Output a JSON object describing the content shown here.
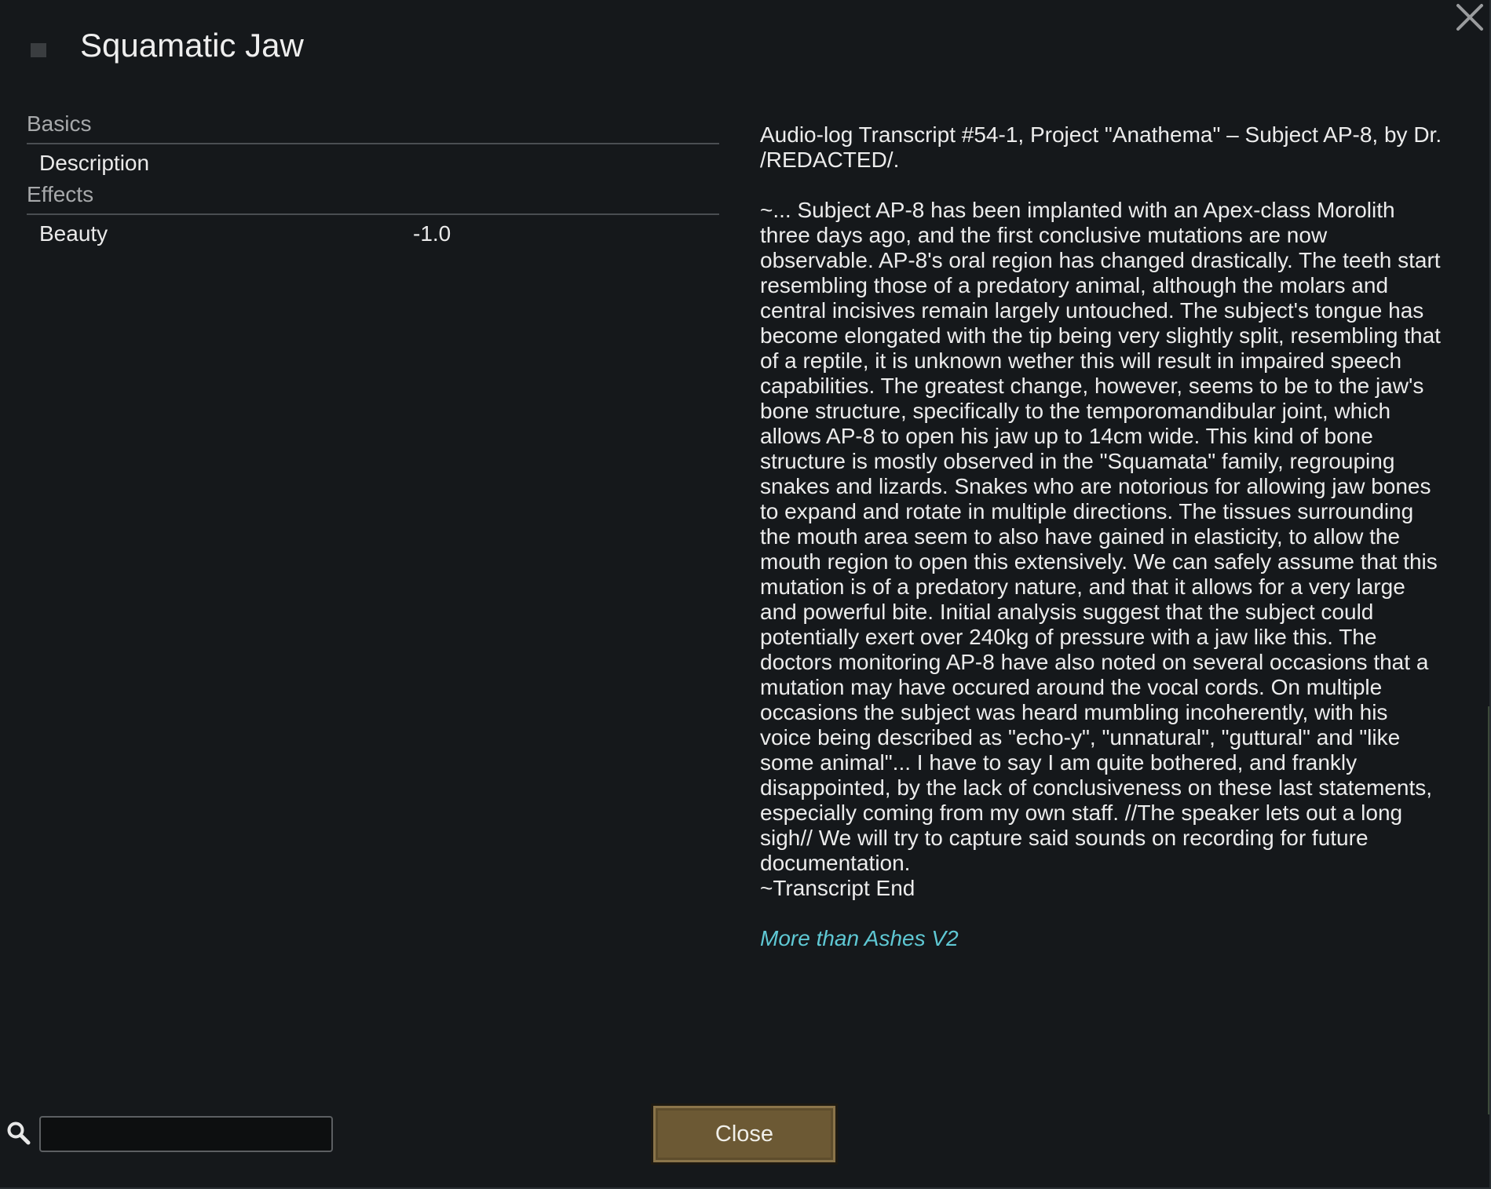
{
  "window": {
    "title": "Squamatic Jaw",
    "close_icon": "close-x-icon"
  },
  "stats": {
    "sections": [
      {
        "header": "Basics",
        "rows": [
          {
            "label": "Description",
            "value": ""
          }
        ]
      },
      {
        "header": "Effects",
        "rows": [
          {
            "label": "Beauty",
            "value": "-1.0"
          }
        ]
      }
    ]
  },
  "description": {
    "heading": "Audio-log Transcript #54-1, Project \"Anathema\" – Subject AP-8, by Dr. /REDACTED/.",
    "body": "~... Subject AP-8 has been implanted with an Apex-class Morolith three days ago, and the first conclusive mutations are now observable. AP-8's oral region has changed drastically. The teeth start resembling those of a predatory animal, although the molars and central incisives remain largely untouched. The subject's tongue has become elongated with the tip being very slightly split, resembling that of a reptile, it is unknown wether this will result in impaired speech capabilities. The greatest change, however, seems to be to the jaw's bone structure, specifically to the temporomandibular joint, which allows AP-8 to open his jaw up to 14cm wide. This kind of bone structure is mostly observed in the \"Squamata\" family, regrouping snakes and lizards. Snakes who are notorious for allowing jaw bones to expand and rotate in multiple directions. The tissues surrounding the mouth area seem to also have gained in elasticity, to allow the mouth region to open this extensively. We can safely assume that this mutation is of a predatory nature, and that it allows for a very large and powerful bite. Initial analysis suggest that the subject could potentially exert over 240kg of pressure with a jaw like this. The doctors monitoring AP-8 have also noted on several occasions that a mutation may have occured around the vocal cords. On multiple occasions the subject was heard mumbling incoherently, with his voice being described as \"echo-y\", \"unnatural\", \"guttural\" and \"like some animal\"... I have to say I am quite bothered, and frankly disappointed, by the lack of conclusiveness on these last statements, especially coming from my own staff. //The speaker lets out a long sigh// We will try to capture said sounds on recording for future documentation.",
    "end": "~Transcript End",
    "mod_name": "More than Ashes V2",
    "mod_color": "#5fc8d4"
  },
  "footer": {
    "search_icon": "search-icon",
    "search_value": "",
    "search_placeholder": "",
    "close_label": "Close",
    "close_color": "#6c5934"
  }
}
